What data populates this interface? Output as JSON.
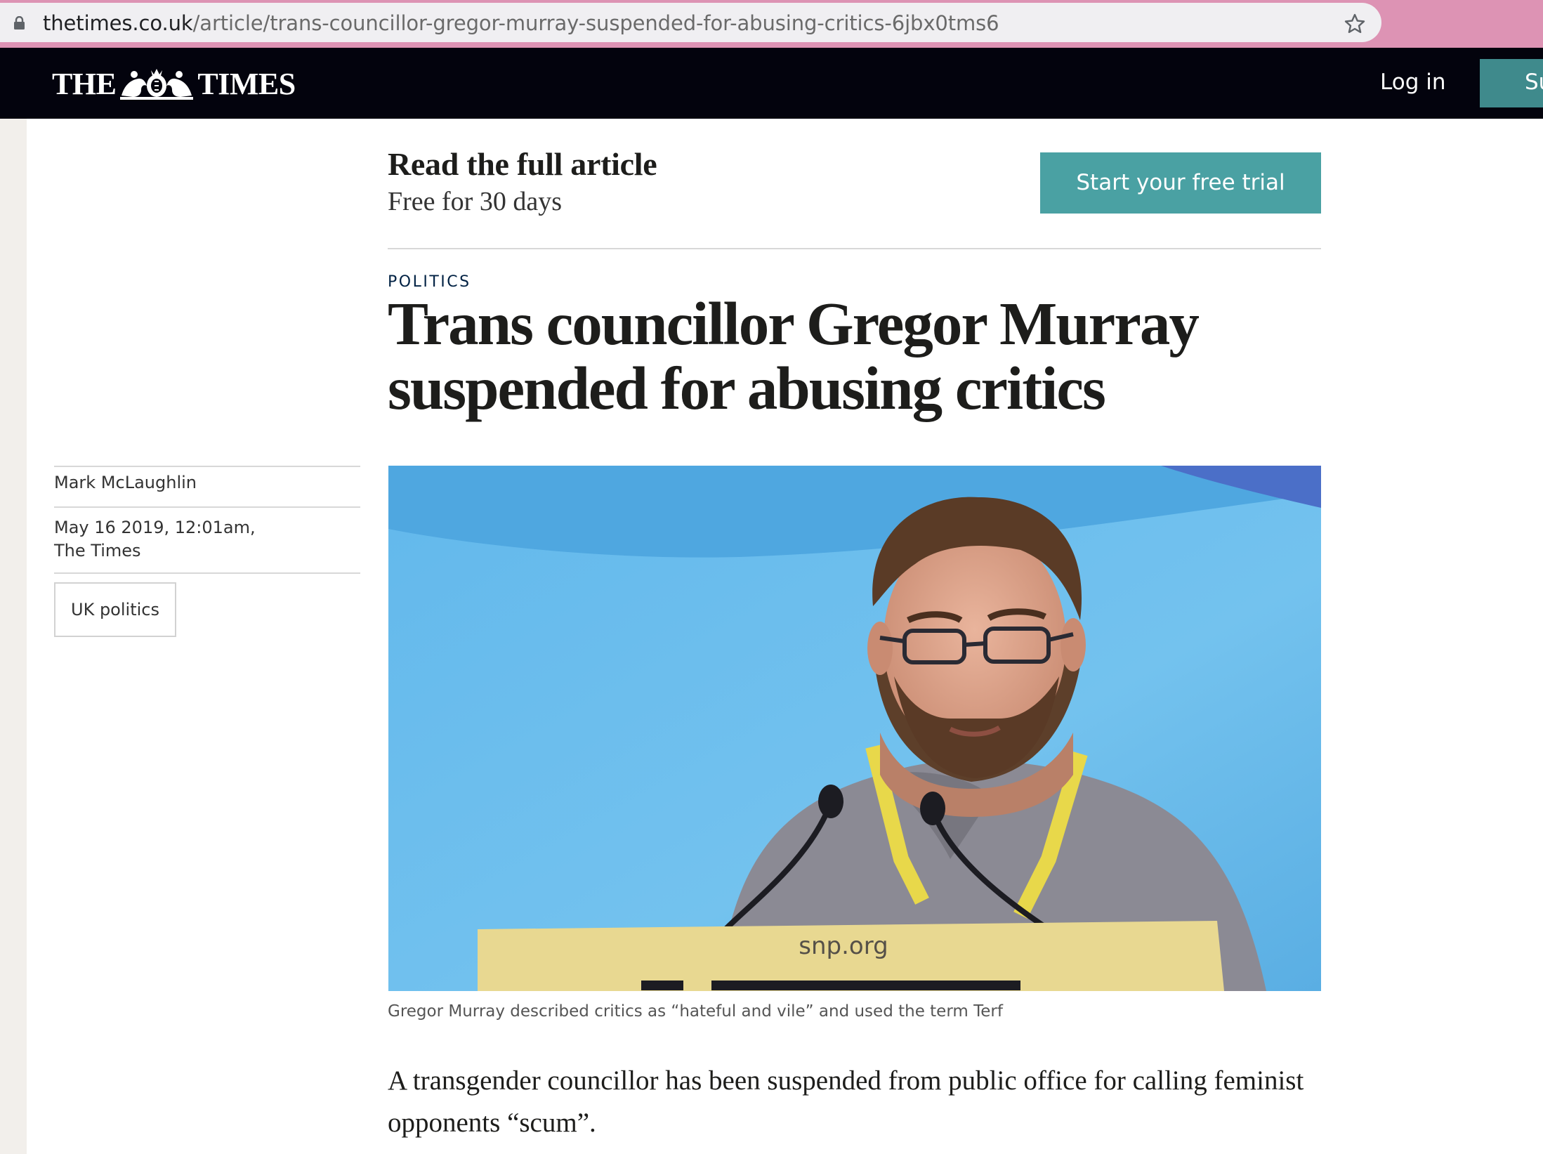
{
  "browser": {
    "url_host": "thetimes.co.uk",
    "url_path": "/article/trans-councillor-gregor-murray-suspended-for-abusing-critics-6jbx0tms6",
    "icons": [
      "lock-icon",
      "star-icon"
    ]
  },
  "masthead": {
    "logo_left": "THE",
    "logo_right": "TIMES",
    "login_label": "Log in",
    "subscribe_label": "Su",
    "background": "#03030d",
    "accent": "#3f8a8c"
  },
  "promo": {
    "title": "Read the full article",
    "subtitle": "Free for 30 days",
    "button_label": "Start your free trial",
    "button_color": "#4aa1a3"
  },
  "article": {
    "section": "POLITICS",
    "headline": "Trans councillor Gregor Murray suspended for abusing critics",
    "author": "Mark McLaughlin",
    "date": "May 16 2019, 12:01am,",
    "publication": "The Times",
    "tag": "UK politics",
    "photo": {
      "podium_text": "snp.org"
    },
    "caption": "Gregor Murray described critics as “hateful and vile” and used the term Terf",
    "lead": "A transgender councillor has been suspended from public office for calling feminist opponents “scum”."
  }
}
